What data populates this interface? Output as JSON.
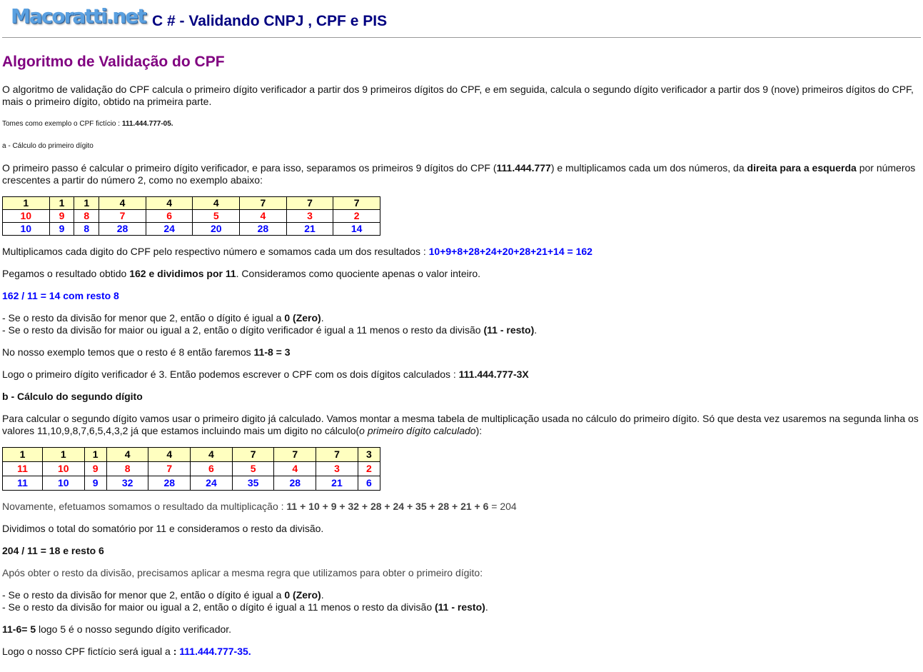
{
  "header": {
    "logo_text": "Macoratti.net",
    "title": "C # - Validando CNPJ , CPF e PIS"
  },
  "page_title": "Algoritmo de Validação do CPF",
  "colors": {
    "title": "#800080",
    "header": "#000080",
    "table_header_bg": "#ffffc0",
    "weights": "#ff0000",
    "products": "#0000ff"
  },
  "blocks": [
    {
      "type": "p",
      "cls": "first",
      "segs": [
        {
          "t": "O algoritmo de validação do CPF calcula o primeiro dígito verificador a partir dos 9 primeiros dígitos do CPF, e em seguida, calcula o segundo dígito verificador a partir dos 9 (nove) primeiros dígitos do CPF, mais o primeiro dígito, obtido na primeira parte."
        }
      ]
    },
    {
      "type": "p",
      "cls": "small",
      "segs": [
        {
          "t": "Tomes como exemplo o CPF fictício : "
        },
        {
          "t": "111.444.777-05.",
          "s": "b"
        }
      ]
    },
    {
      "type": "p",
      "cls": "small",
      "segs": [
        {
          "t": "a - Cálculo do primeiro dígito"
        }
      ]
    },
    {
      "type": "p",
      "segs": [
        {
          "t": "O primeiro passo é calcular o primeiro dígito verificador, e para isso, separamos os primeiros 9 dígitos do CPF ("
        },
        {
          "t": "111.444.777",
          "s": "b"
        },
        {
          "t": ") e multiplicamos cada um dos números, da "
        },
        {
          "t": "direita para a esquerda",
          "s": "b"
        },
        {
          "t": " por números crescentes a partir do número 2, como no exemplo abaixo:"
        }
      ]
    },
    {
      "type": "table",
      "cls": "t1",
      "rows": [
        [
          "1",
          "1",
          "1",
          "4",
          "4",
          "4",
          "7",
          "7",
          "7"
        ],
        [
          "10",
          "9",
          "8",
          "7",
          "6",
          "5",
          "4",
          "3",
          "2"
        ],
        [
          "10",
          "9",
          "8",
          "28",
          "24",
          "20",
          "28",
          "21",
          "14"
        ]
      ]
    },
    {
      "type": "p",
      "segs": [
        {
          "t": "Multiplicamos cada digito do CPF pelo respectivo número e somamos cada um dos resultados : "
        },
        {
          "t": "10+9+8+28+24+20+28+21+14 = 162",
          "s": "blue"
        }
      ]
    },
    {
      "type": "p",
      "segs": [
        {
          "t": "Pegamos o resultado obtido "
        },
        {
          "t": "162 e dividimos por 11",
          "s": "b"
        },
        {
          "t": ".  Consideramos como quociente apenas o valor inteiro."
        }
      ]
    },
    {
      "type": "p",
      "segs": [
        {
          "t": "162 / 11  =   14  com resto 8",
          "s": "blue"
        }
      ]
    },
    {
      "type": "p",
      "segs": [
        {
          "t": "- Se o resto da divisão for menor que 2, então o dígito é igual a "
        },
        {
          "t": "0 (Zero)",
          "s": "b"
        },
        {
          "t": "."
        },
        {
          "br": true
        },
        {
          "t": "- Se o resto da divisão for maior ou igual a 2, então o dígito verificador é igual a 11 menos o resto da divisão "
        },
        {
          "t": "(11 - resto)",
          "s": "b"
        },
        {
          "t": "."
        }
      ]
    },
    {
      "type": "p",
      "segs": [
        {
          "t": "No nosso exemplo temos que o resto é 8 então faremos "
        },
        {
          "t": "11-8 = 3",
          "s": "b"
        }
      ]
    },
    {
      "type": "p",
      "segs": [
        {
          "t": "Logo o primeiro dígito verificador é 3. Então podemos escrever o CPF com os dois dígitos calculados :  "
        },
        {
          "t": "111.444.777-3X",
          "s": "b"
        }
      ]
    },
    {
      "type": "p",
      "segs": [
        {
          "t": "b - Cálculo do segundo dígito",
          "s": "b"
        }
      ]
    },
    {
      "type": "p",
      "segs": [
        {
          "t": "Para  calcular o segundo dígito vamos usar o primeiro digito já calculado. Vamos montar a mesma tabela de multiplicação usada no cálculo do primeiro dígito. Só que desta vez usaremos na segunda linha os valores 11,10,9,8,7,6,5,4,3,2 já que estamos incluindo mais um digito no cálculo("
        },
        {
          "t": "o primeiro dígito calculado",
          "s": "i"
        },
        {
          "t": "):"
        }
      ]
    },
    {
      "type": "table",
      "cls": "t2",
      "rows": [
        [
          "1",
          "1",
          "1",
          "4",
          "4",
          "4",
          "7",
          "7",
          "7",
          "3"
        ],
        [
          "11",
          "10",
          "9",
          "8",
          "7",
          "6",
          "5",
          "4",
          "3",
          "2"
        ],
        [
          "11",
          "10",
          "9",
          "32",
          "28",
          "24",
          "35",
          "28",
          "21",
          "6"
        ]
      ]
    },
    {
      "type": "p",
      "cls": "gray",
      "segs": [
        {
          "t": "Novamente, efetuamos somamos o resultado da multiplicação : "
        },
        {
          "t": "11 + 10 + 9 + 32 + 28 + 24 + 35 + 28 + 21 + 6",
          "s": "b"
        },
        {
          "t": " = 204"
        }
      ]
    },
    {
      "type": "p",
      "segs": [
        {
          "t": "Dividimos o total do somatório por 11 e consideramos o resto da divisão."
        }
      ]
    },
    {
      "type": "p",
      "segs": [
        {
          "t": "204 / 11  =  18  e  resto 6",
          "s": "b"
        }
      ]
    },
    {
      "type": "p",
      "cls": "gray",
      "segs": [
        {
          "t": "Após obter o resto da divisão, precisamos aplicar a mesma regra que utilizamos para obter o primeiro dígito:"
        }
      ]
    },
    {
      "type": "p",
      "segs": [
        {
          "t": "- Se o resto da divisão for menor que 2, então o dígito é igual a "
        },
        {
          "t": "0 (Zero)",
          "s": "b"
        },
        {
          "t": "."
        },
        {
          "br": true
        },
        {
          "t": "- Se o resto da divisão for maior ou igual a 2, então o dígito é igual a 11 menos o resto da divisão "
        },
        {
          "t": "(11 - resto)",
          "s": "b"
        },
        {
          "t": "."
        }
      ]
    },
    {
      "type": "p",
      "segs": [
        {
          "t": "11-6= 5",
          "s": "b"
        },
        {
          "t": "   logo 5 é o nosso segundo dígito verificador."
        }
      ]
    },
    {
      "type": "p",
      "segs": [
        {
          "t": "Logo o nosso CPF fictício será igual a "
        },
        {
          "t": ": ",
          "s": "b"
        },
        {
          "t": "111.444.777-35.",
          "s": "blue"
        }
      ]
    }
  ]
}
